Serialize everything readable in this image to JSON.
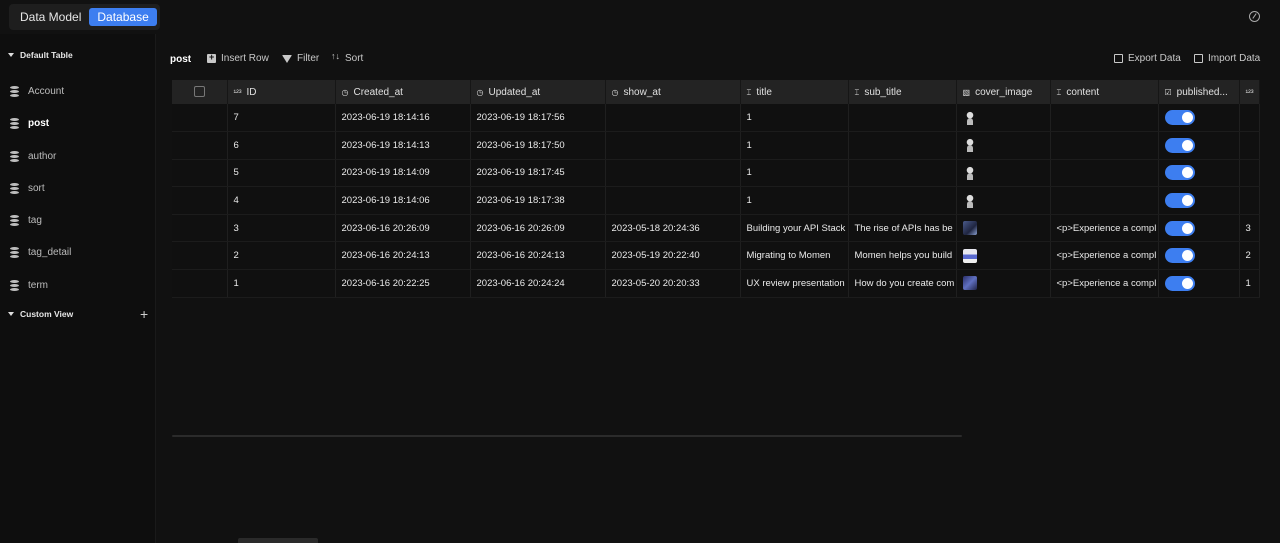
{
  "topbar": {
    "tabs": [
      {
        "label": "Data Model",
        "active": false
      },
      {
        "label": "Database",
        "active": true
      }
    ],
    "accent_color": "#3d7ef0"
  },
  "sidebar": {
    "default_group": "Default Table",
    "tables": [
      {
        "label": "Account",
        "icon": "database-icon"
      },
      {
        "label": "post",
        "icon": "database-icon",
        "active": true
      },
      {
        "label": "author",
        "icon": "database-icon"
      },
      {
        "label": "sort",
        "icon": "database-icon"
      },
      {
        "label": "tag",
        "icon": "database-icon"
      },
      {
        "label": "tag_detail",
        "icon": "database-icon"
      },
      {
        "label": "term",
        "icon": "database-icon"
      }
    ],
    "custom_group": "Custom View",
    "add_icon": "plus-icon"
  },
  "toolbar": {
    "table_name": "post",
    "insert_row": "Insert Row",
    "filter": "Filter",
    "sort": "Sort",
    "export": "Export Data",
    "import": "Import Data"
  },
  "grid": {
    "columns": [
      {
        "label": "ID",
        "icon": "number-icon"
      },
      {
        "label": "Created_at",
        "icon": "clock-icon"
      },
      {
        "label": "Updated_at",
        "icon": "clock-icon"
      },
      {
        "label": "show_at",
        "icon": "clock-icon"
      },
      {
        "label": "title",
        "icon": "text-icon"
      },
      {
        "label": "sub_title",
        "icon": "text-icon"
      },
      {
        "label": "cover_image",
        "icon": "image-icon"
      },
      {
        "label": "content",
        "icon": "text-icon"
      },
      {
        "label": "published...",
        "icon": "checkbox-icon"
      },
      {
        "label": "",
        "icon": "number-icon"
      }
    ],
    "rows": [
      {
        "id": "7",
        "created": "2023-06-19 18:14:16",
        "updated": "2023-06-19 18:17:56",
        "show": "",
        "title": "1",
        "sub": "",
        "img": "person",
        "content": "",
        "published": true,
        "extra": ""
      },
      {
        "id": "6",
        "created": "2023-06-19 18:14:13",
        "updated": "2023-06-19 18:17:50",
        "show": "",
        "title": "1",
        "sub": "",
        "img": "person",
        "content": "",
        "published": true,
        "extra": ""
      },
      {
        "id": "5",
        "created": "2023-06-19 18:14:09",
        "updated": "2023-06-19 18:17:45",
        "show": "",
        "title": "1",
        "sub": "",
        "img": "person",
        "content": "",
        "published": true,
        "extra": ""
      },
      {
        "id": "4",
        "created": "2023-06-19 18:14:06",
        "updated": "2023-06-19 18:17:38",
        "show": "",
        "title": "1",
        "sub": "",
        "img": "person",
        "content": "",
        "published": true,
        "extra": ""
      },
      {
        "id": "3",
        "created": "2023-06-16 20:26:09",
        "updated": "2023-06-16 20:26:09",
        "show": "2023-05-18 20:24:36",
        "title": "Building your API Stack",
        "sub": "The rise of APIs has be",
        "img": "shot1",
        "content": "<p>Experience a compl",
        "published": true,
        "extra": "3"
      },
      {
        "id": "2",
        "created": "2023-06-16 20:24:13",
        "updated": "2023-06-16 20:24:13",
        "show": "2023-05-19 20:22:40",
        "title": "Migrating to Momen",
        "sub": "Momen helps you build",
        "img": "shot2",
        "content": "<p>Experience a compl",
        "published": true,
        "extra": "2"
      },
      {
        "id": "1",
        "created": "2023-06-16 20:22:25",
        "updated": "2023-06-16 20:24:24",
        "show": "2023-05-20 20:20:33",
        "title": "UX review presentation",
        "sub": "How do you create com",
        "img": "shot3",
        "content": "<p>Experience a compl",
        "published": true,
        "extra": "1"
      }
    ]
  }
}
